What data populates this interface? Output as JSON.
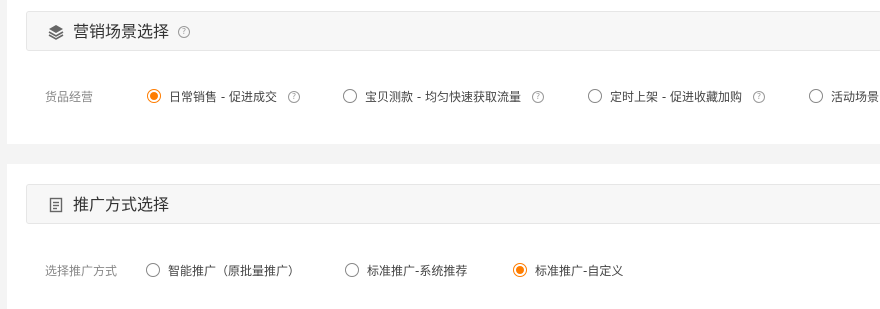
{
  "scene_section": {
    "title": "营销场景选择",
    "help": "?",
    "row_label": "货品经营",
    "options": [
      {
        "label": "日常销售 - 促进成交",
        "checked": true,
        "has_help": true
      },
      {
        "label": "宝贝测款 - 均匀快速获取流量",
        "checked": false,
        "has_help": true
      },
      {
        "label": "定时上架 - 促进收藏加购",
        "checked": false,
        "has_help": true
      },
      {
        "label": "活动场景",
        "checked": false,
        "has_help": false
      }
    ]
  },
  "promo_section": {
    "title": "推广方式选择",
    "row_label": "选择推广方式",
    "options": [
      {
        "label": "智能推广（原批量推广）",
        "checked": false
      },
      {
        "label": "标准推广-系统推荐",
        "checked": false
      },
      {
        "label": "标准推广-自定义",
        "checked": true
      }
    ]
  },
  "icons": {
    "scene_header": "layers-icon",
    "promo_header": "document-icon",
    "help": "question-circle-icon"
  },
  "colors": {
    "accent": "#ff7d00",
    "background": "#f4f4f4"
  }
}
